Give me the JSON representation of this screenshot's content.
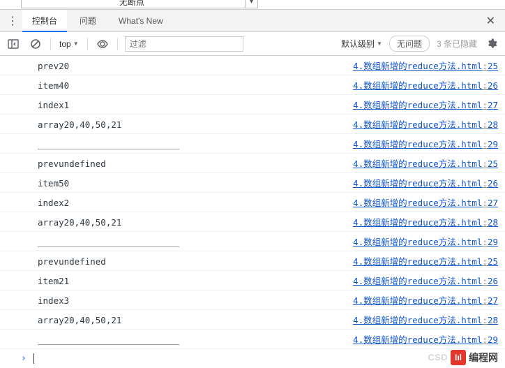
{
  "top_remnant": {
    "text": "无断点"
  },
  "tabs": {
    "console": "控制台",
    "issues": "问题",
    "whatsnew": "What's New"
  },
  "toolbar": {
    "context": "top",
    "filter_placeholder": "过滤",
    "level_label": "默认级别",
    "no_issues": "无问题",
    "hidden_count": "3 条已隐藏"
  },
  "source": {
    "filename": "4.数组新增的reduce方法.html"
  },
  "logs": [
    {
      "msg": "prev20",
      "line": 25
    },
    {
      "msg": "item40",
      "line": 26
    },
    {
      "msg": "index1",
      "line": 27
    },
    {
      "msg": "array20,40,50,21",
      "line": 28
    },
    {
      "msg": "___________________________",
      "line": 29
    },
    {
      "msg": "prevundefined",
      "line": 25
    },
    {
      "msg": "item50",
      "line": 26
    },
    {
      "msg": "index2",
      "line": 27
    },
    {
      "msg": "array20,40,50,21",
      "line": 28
    },
    {
      "msg": "___________________________",
      "line": 29
    },
    {
      "msg": "prevundefined",
      "line": 25
    },
    {
      "msg": "item21",
      "line": 26
    },
    {
      "msg": "index3",
      "line": 27
    },
    {
      "msg": "array20,40,50,21",
      "line": 28
    },
    {
      "msg": "___________________________",
      "line": 29
    }
  ],
  "watermark": {
    "csdn": "CSD",
    "logo": "Iıl",
    "text": "编程网"
  }
}
